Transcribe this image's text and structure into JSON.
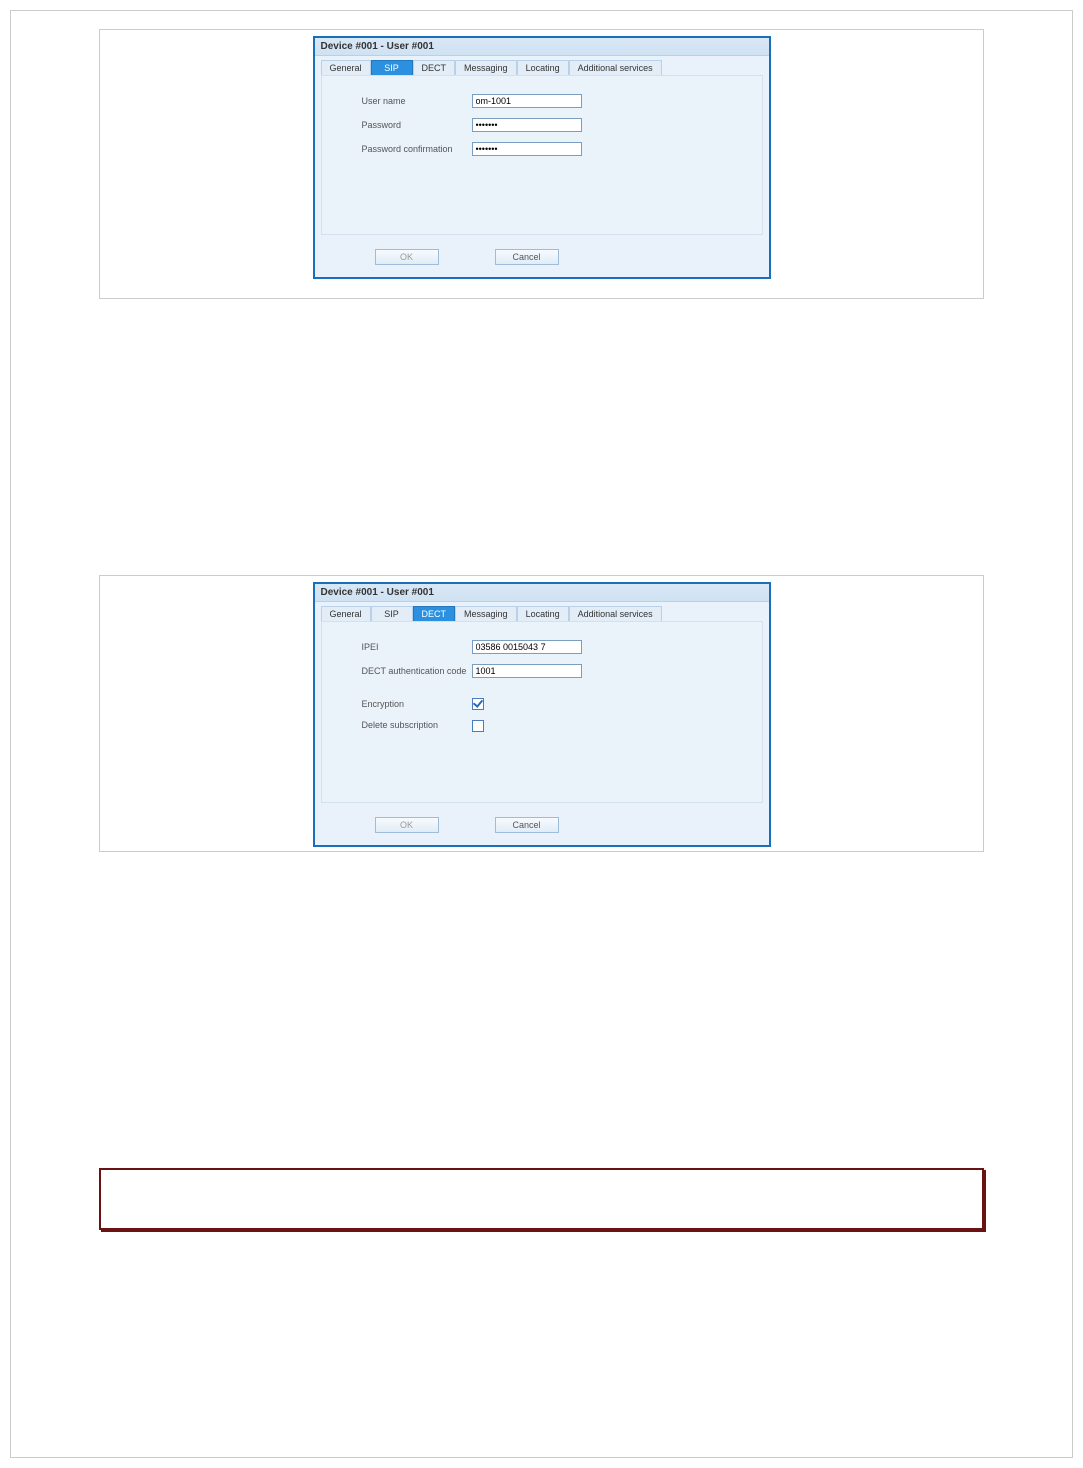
{
  "dialog_sip": {
    "title": "Device #001 - User #001",
    "tabs": {
      "general": "General",
      "sip": "SIP",
      "dect": "DECT",
      "messaging": "Messaging",
      "locating": "Locating",
      "additional": "Additional services"
    },
    "fields": {
      "username_label": "User name",
      "username_value": "om-1001",
      "password_label": "Password",
      "password_value": "·······",
      "password_conf_label": "Password confirmation",
      "password_conf_value": "·······"
    },
    "buttons": {
      "ok": "OK",
      "cancel": "Cancel"
    }
  },
  "dialog_dect": {
    "title": "Device #001 - User #001",
    "tabs": {
      "general": "General",
      "sip": "SIP",
      "dect": "DECT",
      "messaging": "Messaging",
      "locating": "Locating",
      "additional": "Additional services"
    },
    "fields": {
      "ipei_label": "IPEI",
      "ipei_value": "03586 0015043 7",
      "authcode_label": "DECT authentication code",
      "authcode_value": "1001",
      "encryption_label": "Encryption",
      "delete_sub_label": "Delete subscription"
    },
    "encryption_checked": true,
    "delete_sub_checked": false,
    "buttons": {
      "ok": "OK",
      "cancel": "Cancel"
    }
  }
}
